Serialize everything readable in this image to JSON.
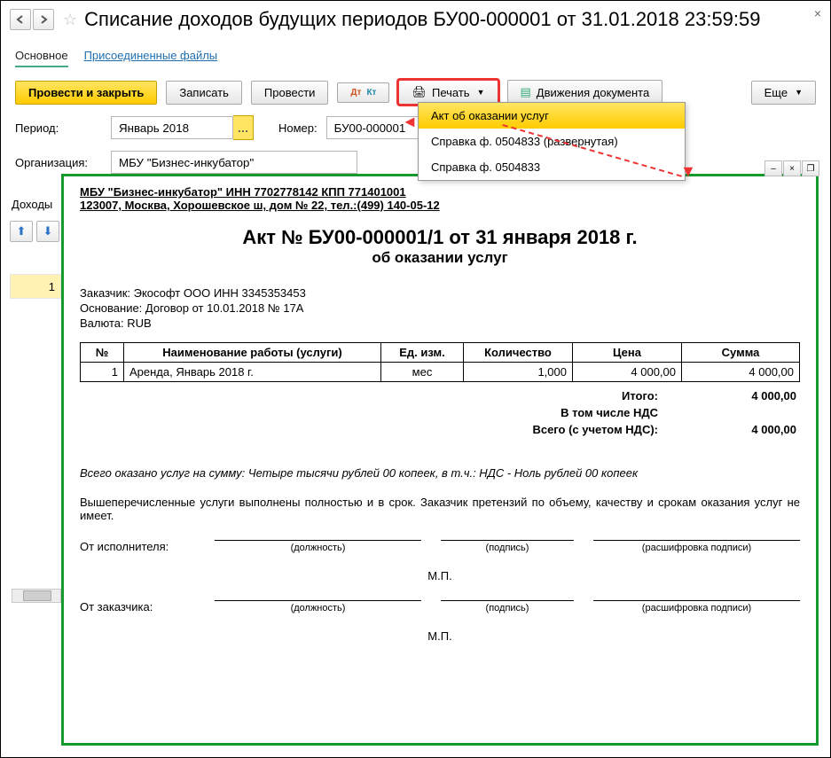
{
  "titlebar": {
    "title": "Списание доходов будущих периодов БУ00-000001 от 31.01.2018 23:59:59"
  },
  "tabs": {
    "main": "Основное",
    "attachments": "Присоединенные файлы"
  },
  "toolbar": {
    "post_close": "Провести и закрыть",
    "save": "Записать",
    "post": "Провести",
    "print": "Печать",
    "movements": "Движения документа",
    "more": "Еще"
  },
  "fields": {
    "period_label": "Период:",
    "period_value": "Январь 2018",
    "number_label": "Номер:",
    "number_value": "БУ00-000001",
    "org_label": "Организация:",
    "org_value": "МБУ \"Бизнес-инкубатор\""
  },
  "print_menu": [
    "Акт об оказании услуг",
    "Справка ф. 0504833 (развернутая)",
    "Справка ф. 0504833"
  ],
  "subtabs": {
    "income": "Доходы"
  },
  "left_row_num": "1",
  "act": {
    "org_line1": "МБУ \"Бизнес-инкубатор\" ИНН 7702778142 КПП 771401001",
    "org_line2": "123007, Москва, Хорошевское ш, дом № 22, тел.:(499) 140-05-12",
    "title": "Акт № БУ00-000001/1 от 31 января 2018 г.",
    "subtitle": "об оказании услуг",
    "customer": "Заказчик: Экософт ООО ИНН 3345353453",
    "basis": "Основание: Договор от 10.01.2018 № 17А",
    "currency": "Валюта: RUB",
    "table": {
      "headers": [
        "№",
        "Наименование работы (услуги)",
        "Ед. изм.",
        "Количество",
        "Цена",
        "Сумма"
      ],
      "rows": [
        {
          "num": "1",
          "name": "Аренда, Январь 2018 г.",
          "unit": "мес",
          "qty": "1,000",
          "price": "4 000,00",
          "sum": "4 000,00"
        }
      ]
    },
    "totals": {
      "itogo_label": "Итого:",
      "itogo": "4 000,00",
      "nds_label": "В том числе НДС",
      "nds": "",
      "vsego_label": "Всего (с учетом НДС):",
      "vsego": "4 000,00"
    },
    "sum_words": "Всего оказано услуг на сумму:   Четыре тысячи рублей 00 копеек, в т.ч.: НДС - Ноль рублей 00 копеек",
    "clause": "Вышеперечисленные услуги выполнены полностью и в срок. Заказчик претензий по объему, качеству и срокам оказания услуг не имеет.",
    "sign": {
      "executor": "От исполнителя:",
      "customer": "От заказчика:",
      "position": "(должность)",
      "signature": "(подпись)",
      "decipher": "(расшифровка подписи)",
      "mp": "М.П."
    }
  }
}
